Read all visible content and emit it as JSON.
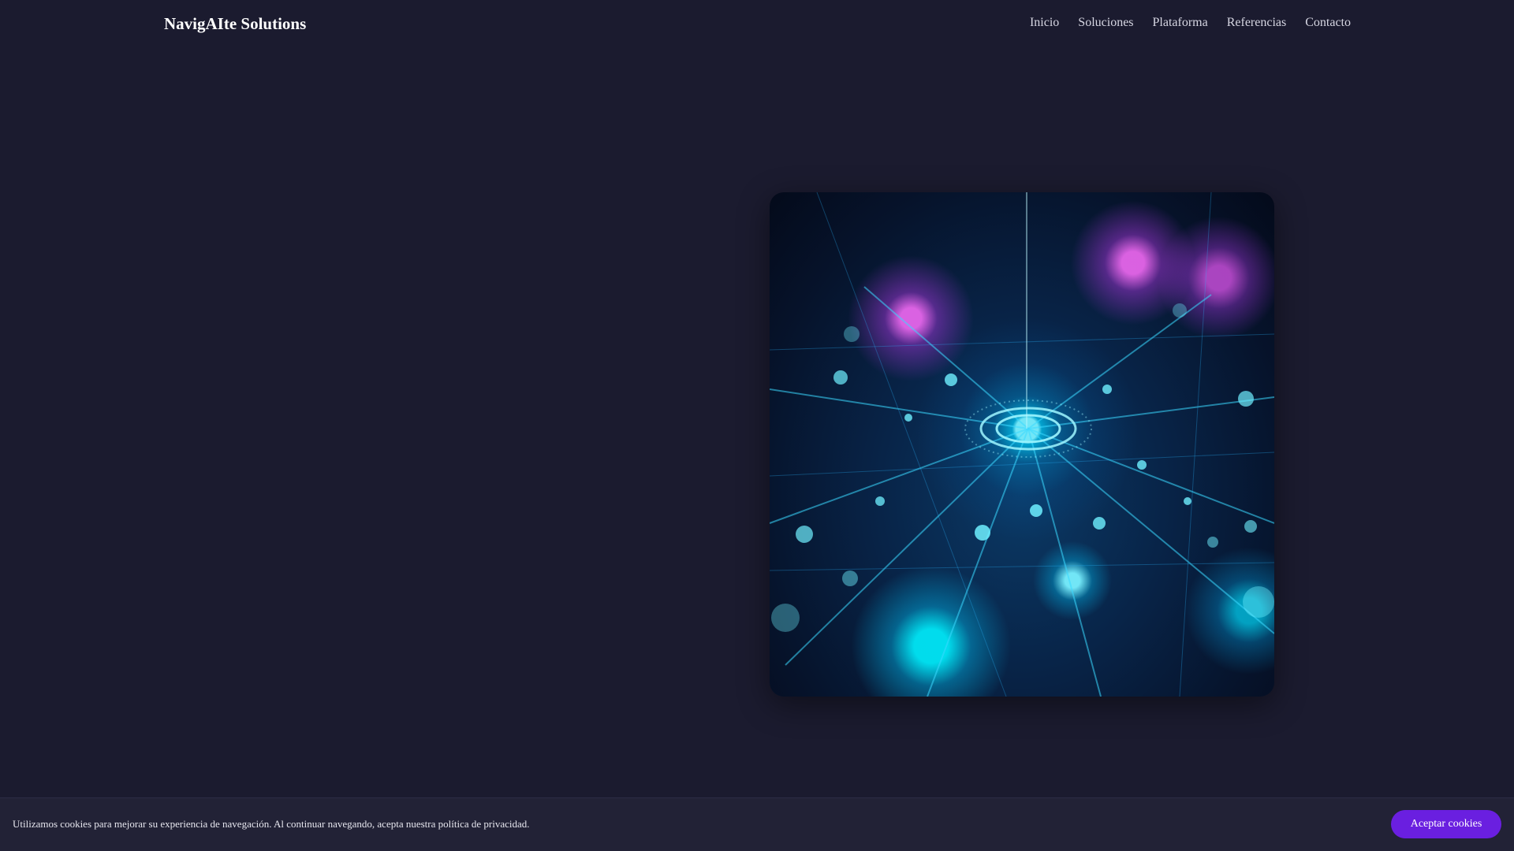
{
  "header": {
    "brand": "NavigAIte Solutions",
    "nav": [
      {
        "label": "Inicio"
      },
      {
        "label": "Soluciones"
      },
      {
        "label": "Plataforma"
      },
      {
        "label": "Referencias"
      },
      {
        "label": "Contacto"
      }
    ]
  },
  "hero": {
    "image_subject": "network-hub-illustration",
    "colors": {
      "background": "#1b1b2f",
      "cyan_glow": "#00e0ff",
      "magenta_glow": "#e060ff"
    }
  },
  "cookie_banner": {
    "message": "Utilizamos cookies para mejorar su experiencia de navegación. Al continuar navegando, acepta nuestra política de privacidad.",
    "accept_label": "Aceptar cookies",
    "accent_color": "#6a1fe0"
  }
}
